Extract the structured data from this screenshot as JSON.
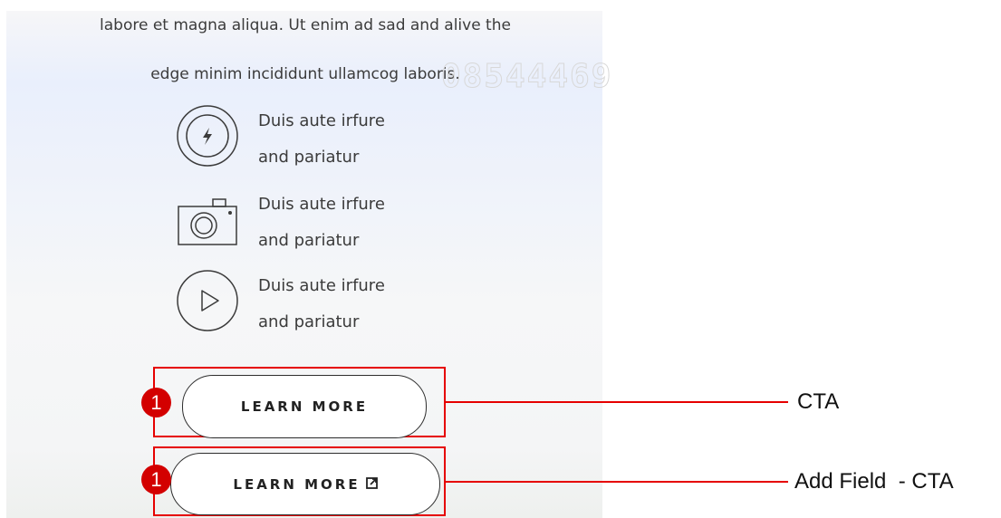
{
  "intro": {
    "line1": "labore et magna aliqua. Ut enim ad sad and alive the",
    "line2": "edge minim incididunt ullamcog laboris.",
    "watermark": "08544469"
  },
  "features": [
    {
      "icon": "flash-icon",
      "line1": "Duis aute irfure",
      "line2": "and pariatur"
    },
    {
      "icon": "camera-icon",
      "line1": "Duis aute irfure",
      "line2": "and pariatur"
    },
    {
      "icon": "play-icon",
      "line1": "Duis aute irfure",
      "line2": "and pariatur"
    }
  ],
  "cta": {
    "badge": "1",
    "label": "LEARN MORE",
    "callout": "CTA"
  },
  "cta_external": {
    "badge": "1",
    "label": "LEARN MORE",
    "icon": "external-link-icon",
    "callout": "Add Field  - CTA"
  },
  "colors": {
    "annotation": "#e60000",
    "badge": "#d30000",
    "text": "#3b3b3b"
  }
}
